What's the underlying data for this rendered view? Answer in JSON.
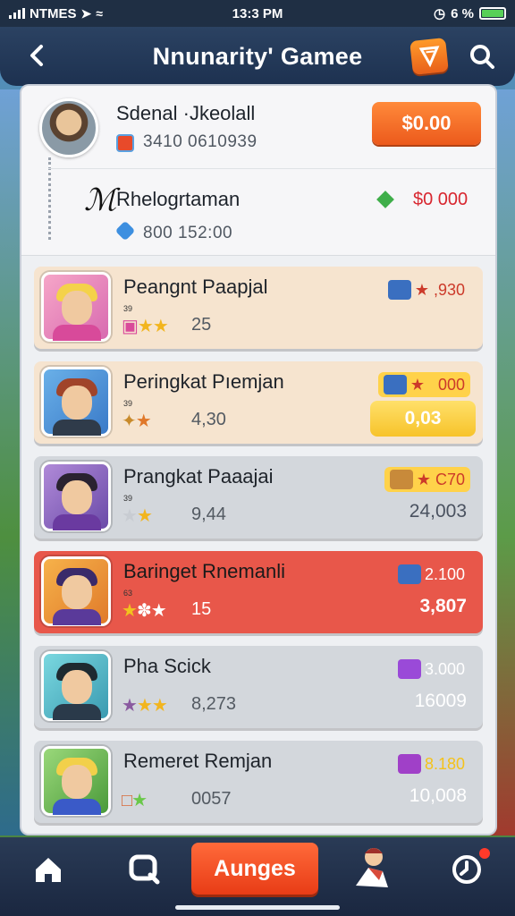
{
  "status_bar": {
    "carrier": "NTMES",
    "time": "13:3 PM",
    "battery_text": "6 %"
  },
  "header": {
    "title": "Nnunarity' Gamee",
    "back_icon": "chevron-left-icon",
    "ticket_icon": "ticket-icon",
    "search_icon": "search-icon"
  },
  "profile": {
    "player1": {
      "name": "Sdenal ·Jkeolall",
      "id": "3410 0610939",
      "coins": "$0.00"
    },
    "player2": {
      "name": "Rhelogrtaman",
      "id": "800 152:00",
      "amount": "$0 000"
    }
  },
  "leaderboard": [
    {
      "title": "Peangnt Paapjal",
      "sub": "39",
      "score": "25",
      "badge": "★ ,930",
      "total": "",
      "bg": "#f6e4cf",
      "badge_color": "#cc3a2a"
    },
    {
      "title": "Peringkat Pıemjan",
      "sub": "39",
      "score": "4,30",
      "badge": "★   000",
      "total": "0,03",
      "bg": "#f6e4cf",
      "badge_color": "#cc3a2a"
    },
    {
      "title": "Prangkat Paaajai",
      "sub": "39",
      "score": "9,44",
      "badge": "★ C70",
      "total": "24,003",
      "bg": "#d3d7dc",
      "badge_color": "#cc3a2a"
    },
    {
      "title": "Baringet Rnemanli",
      "sub": "63",
      "score": "15",
      "badge": "2.100",
      "total": "3,807",
      "bg": "#e8574a",
      "badge_color": "#ffffff"
    },
    {
      "title": "Pha Scick",
      "sub": "",
      "score": "8,273",
      "badge": "3.000",
      "total": "16009",
      "bg": "#d3d7dc",
      "badge_color": "#ffffff"
    },
    {
      "title": "Remeret Remjan",
      "sub": "",
      "score": "0057",
      "badge": "8.180",
      "total": "10,008",
      "bg": "#d3d7dc",
      "badge_color": "#f4c21a"
    }
  ],
  "nav": {
    "home_icon": "home-icon",
    "search_icon": "search-icon",
    "main_label": "Aunges",
    "avatar_icon": "player-avatar-icon",
    "clock_icon": "clock-icon"
  },
  "colors": {
    "accent": "#ec5a1c",
    "header": "#1d3150",
    "red_row": "#e8574a",
    "gold": "#f7c32a"
  }
}
